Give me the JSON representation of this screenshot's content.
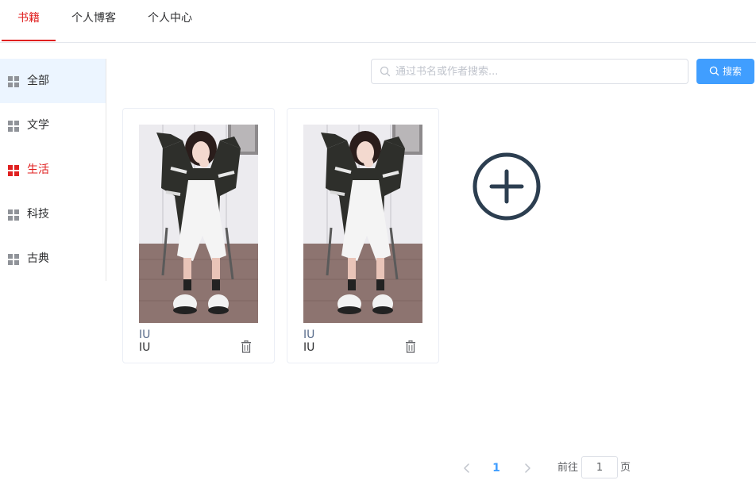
{
  "tabs": [
    {
      "label": "书籍",
      "active": true
    },
    {
      "label": "个人博客",
      "active": false
    },
    {
      "label": "个人中心",
      "active": false
    }
  ],
  "sidebar": {
    "items": [
      {
        "label": "全部",
        "icon": "grid-icon"
      },
      {
        "label": "文学",
        "icon": "grid-icon"
      },
      {
        "label": "生活",
        "icon": "grid-icon",
        "active": true
      },
      {
        "label": "科技",
        "icon": "grid-icon"
      },
      {
        "label": "古典",
        "icon": "grid-icon"
      }
    ]
  },
  "search": {
    "placeholder": "通过书名或作者搜索...",
    "value": "",
    "button_label": "搜索"
  },
  "books": [
    {
      "title": "IU",
      "author": "IU"
    },
    {
      "title": "IU",
      "author": "IU"
    }
  ],
  "pagination": {
    "current_page": "1",
    "goto_label": "前往",
    "goto_value": "1",
    "page_suffix": "页"
  },
  "colors": {
    "accent_red": "#e02020",
    "primary_blue": "#409eff",
    "sidebar_selected_bg": "#ecf5ff",
    "add_icon": "#2c3e50"
  }
}
